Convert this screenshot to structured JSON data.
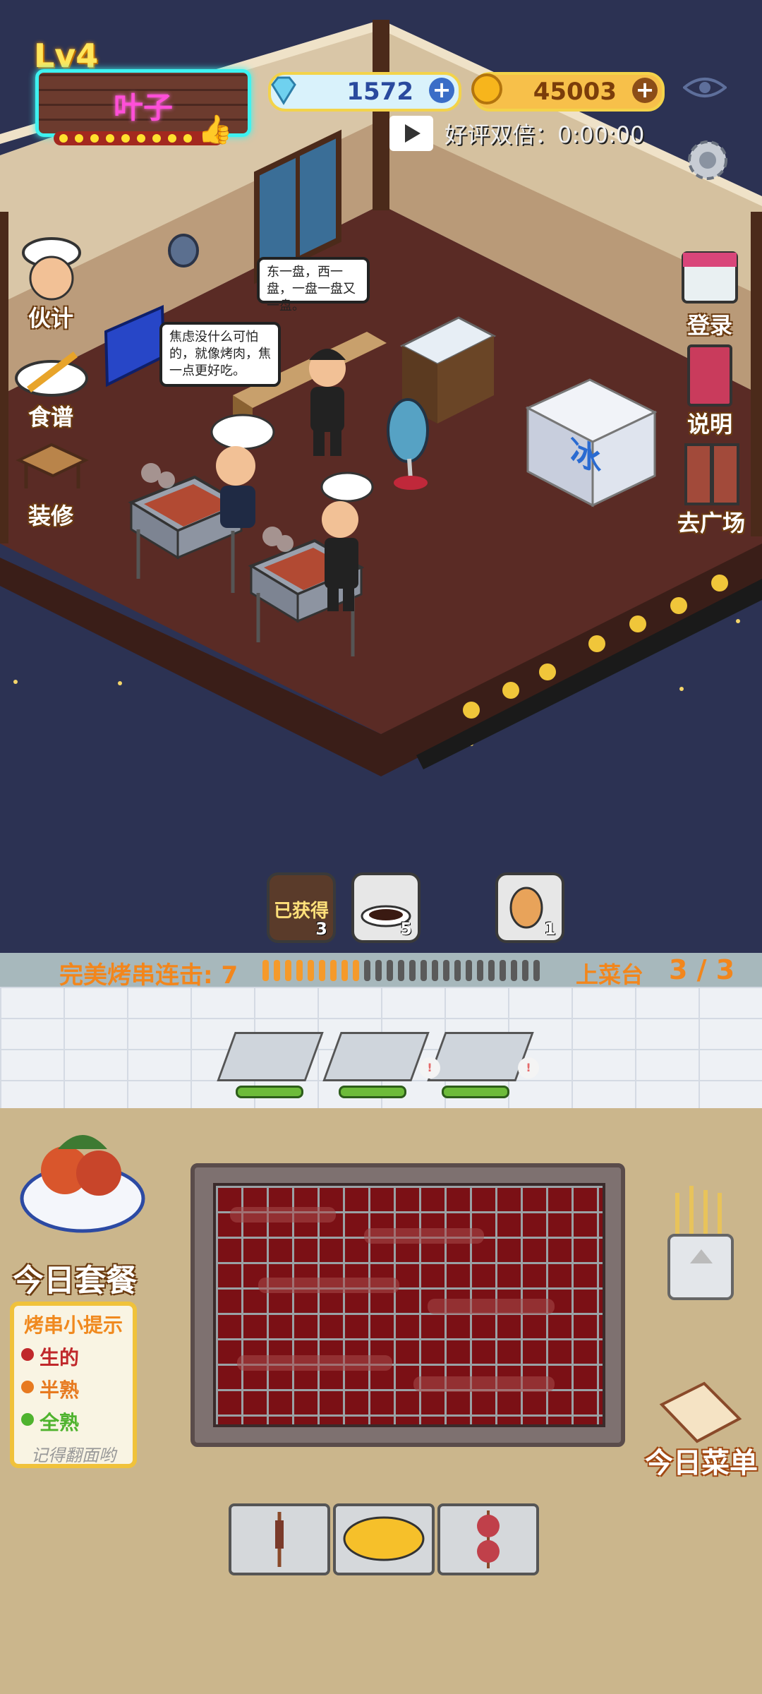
{
  "hud": {
    "level": "Lv4",
    "player_name": "叶子",
    "diamonds": "1572",
    "coins": "45003",
    "double_reward_label": "好评双倍：0:00:00"
  },
  "left_menu": [
    {
      "label": "伙计",
      "icon": "chef-icon"
    },
    {
      "label": "食谱",
      "icon": "skewer-plate-icon"
    },
    {
      "label": "装修",
      "icon": "table-icon"
    }
  ],
  "right_menu": [
    {
      "label": "登录",
      "icon": "calendar-icon"
    },
    {
      "label": "说明",
      "icon": "book-icon"
    },
    {
      "label": "去广场",
      "icon": "door-icon"
    }
  ],
  "bubbles": {
    "chef_speech": "东一盘，西一盘，一盘一盘又一盘。",
    "cook_speech": "焦虑没什么可怕的，就像烤肉，焦一点更好吃。"
  },
  "freezer_label": "冰",
  "items": [
    {
      "label": "已获得",
      "count": "3"
    },
    {
      "label": "",
      "count": "5"
    },
    {
      "label": "",
      "count": "1"
    }
  ],
  "combo": {
    "label": "完美烤串连击:",
    "value": "7",
    "plate_label": "上菜台",
    "plate_count": "3 / 3"
  },
  "bottom": {
    "meal_label": "今日套餐",
    "menu_label": "今日菜单",
    "tips": {
      "title": "烤串小提示",
      "raw": "生的",
      "half": "半熟",
      "done": "全熟",
      "note": "记得翻面哟"
    }
  },
  "colors": {
    "accent_orange": "#f2861c",
    "neon_cyan": "#3ef2f0",
    "neon_pink": "#ff4fd8",
    "raw_red": "#c0282b",
    "half_orange": "#e77a20",
    "done_green": "#4fb32e"
  }
}
